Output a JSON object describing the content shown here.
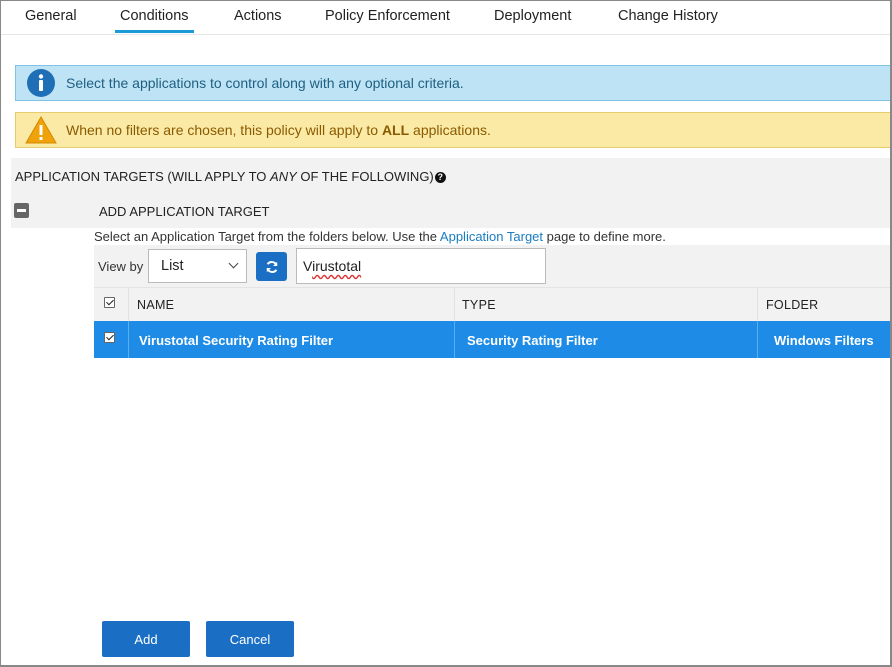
{
  "tabs": [
    {
      "label": "General",
      "active": false
    },
    {
      "label": "Conditions",
      "active": true
    },
    {
      "label": "Actions",
      "active": false
    },
    {
      "label": "Policy Enforcement",
      "active": false
    },
    {
      "label": "Deployment",
      "active": false
    },
    {
      "label": "Change History",
      "active": false
    }
  ],
  "alerts": {
    "info": {
      "icon": "info-icon",
      "text": "Select the applications to control along with any optional criteria."
    },
    "warning": {
      "icon": "warning-icon",
      "text_before": "When no filters are chosen, this policy will apply to ",
      "text_bold": "ALL",
      "text_after": " applications."
    }
  },
  "section": {
    "title_before": "APPLICATION TARGETS (WILL APPLY TO ",
    "title_em": "ANY",
    "title_after": " OF THE FOLLOWING)",
    "help_icon": "question-circle-icon",
    "add_title": "ADD APPLICATION TARGET",
    "help_before": "Select an Application Target from the folders below. Use the ",
    "help_link": "Application Target",
    "help_after": " page to define more."
  },
  "filter": {
    "view_by_label": "View by",
    "view_by_value": "List",
    "refresh_icon": "refresh-icon",
    "search_value_first": "V",
    "search_value_rest": "irustotal"
  },
  "table": {
    "headers": [
      "NAME",
      "TYPE",
      "FOLDER"
    ],
    "select_all_checked": true,
    "rows": [
      {
        "name": "Virustotal Security Rating Filter",
        "type": "Security Rating Filter",
        "folder": "Windows Filters",
        "checked": true,
        "selected": true
      }
    ]
  },
  "buttons": {
    "add": "Add",
    "cancel": "Cancel"
  },
  "colors": {
    "accent": "#1a6fc4",
    "tab_underline": "#1a9ad6",
    "selected_row": "#1e8ce6",
    "info_bg": "#bde3f5",
    "warn_bg": "#fbeaa6"
  }
}
